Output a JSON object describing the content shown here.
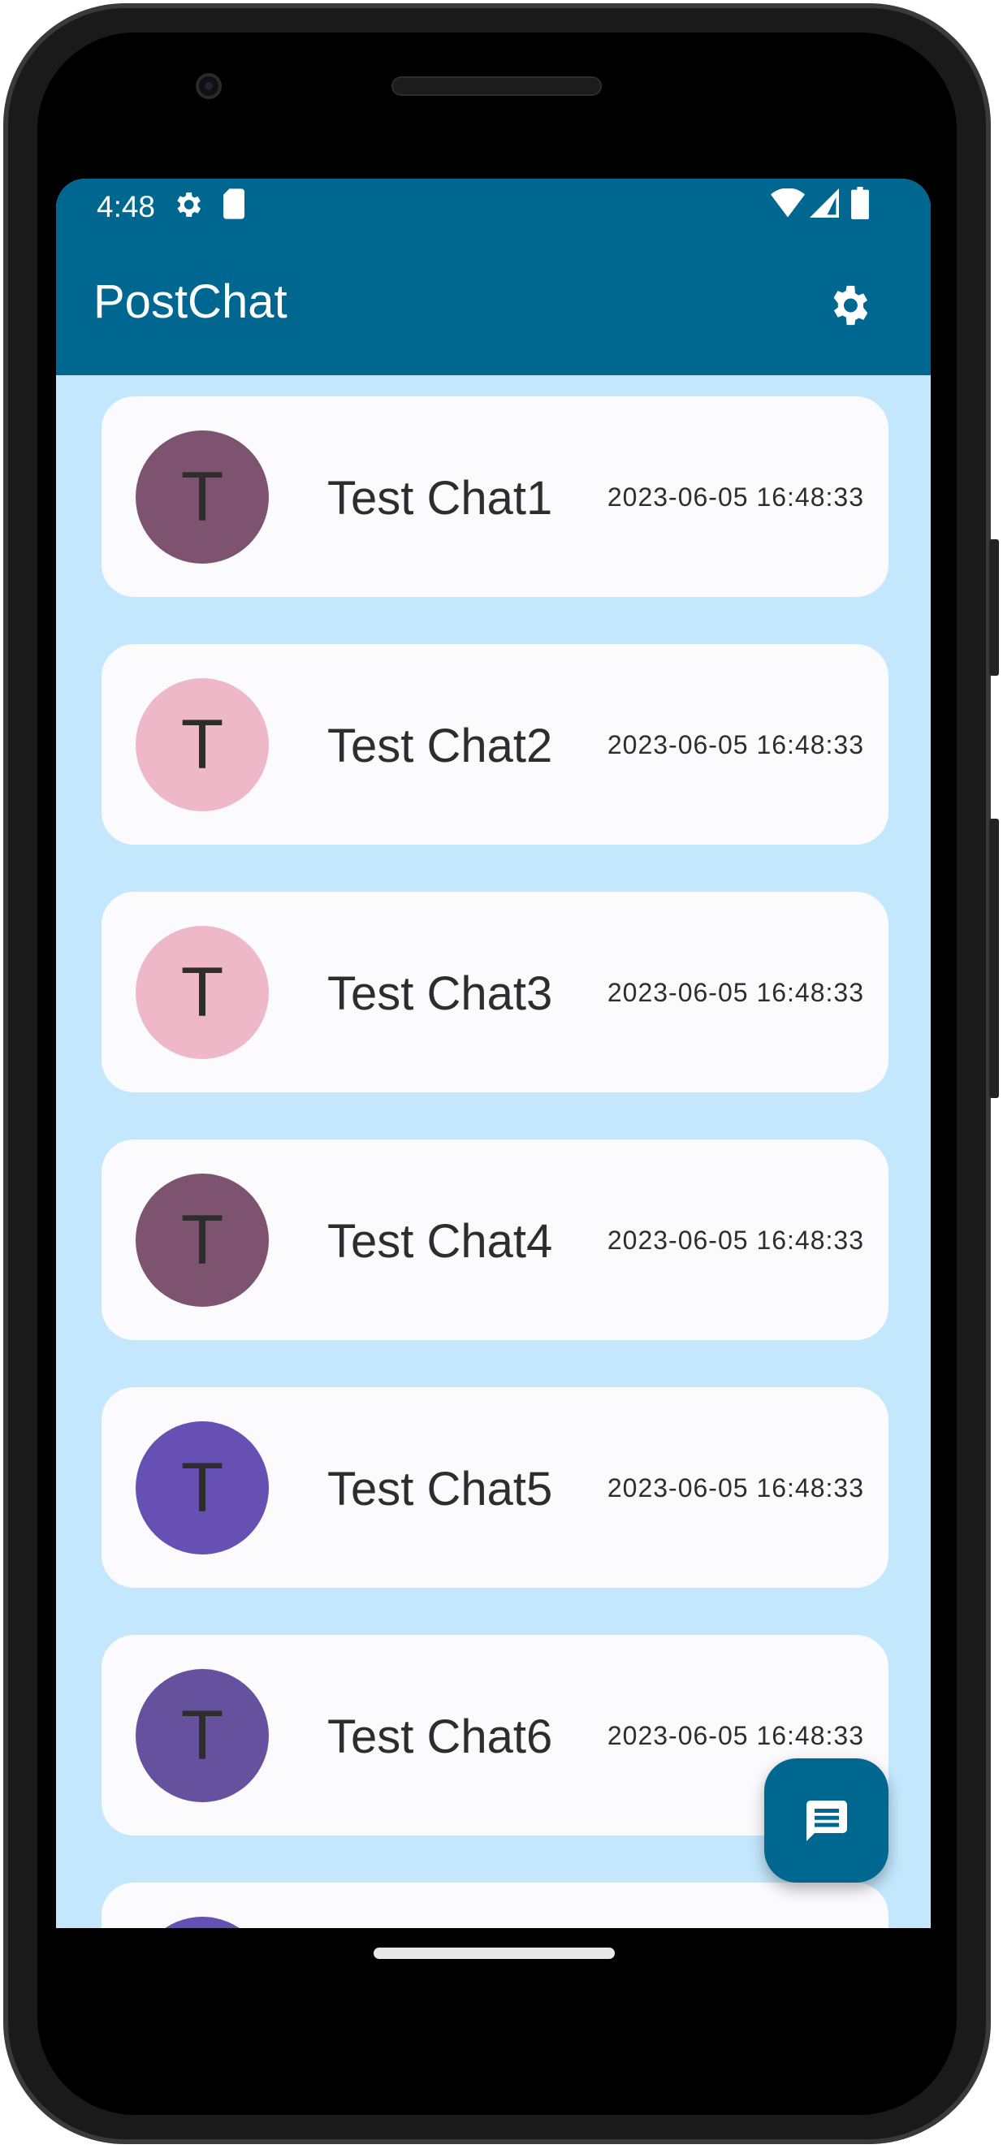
{
  "status_bar": {
    "time": "4:48",
    "icons": [
      "settings-gear-icon",
      "sd-card-icon",
      "wifi-icon",
      "signal-icon",
      "battery-icon"
    ]
  },
  "app_bar": {
    "title": "PostChat",
    "action_icon": "settings-icon"
  },
  "colors": {
    "primary": "#006890",
    "background": "#c3e7fd",
    "card": "#fbfbfe"
  },
  "chats": [
    {
      "initial": "T",
      "name": "Test Chat1",
      "timestamp": "2023-06-05 16:48:33",
      "avatar_color": "#7d5370"
    },
    {
      "initial": "T",
      "name": "Test Chat2",
      "timestamp": "2023-06-05 16:48:33",
      "avatar_color": "#efb8c8"
    },
    {
      "initial": "T",
      "name": "Test Chat3",
      "timestamp": "2023-06-05 16:48:33",
      "avatar_color": "#efb8c8"
    },
    {
      "initial": "T",
      "name": "Test Chat4",
      "timestamp": "2023-06-05 16:48:33",
      "avatar_color": "#7d5370"
    },
    {
      "initial": "T",
      "name": "Test Chat5",
      "timestamp": "2023-06-05 16:48:33",
      "avatar_color": "#6750b4"
    },
    {
      "initial": "T",
      "name": "Test Chat6",
      "timestamp": "2023-06-05 16:48:33",
      "avatar_color": "#66519f"
    },
    {
      "initial": "",
      "name": "",
      "timestamp": "",
      "avatar_color": "#6750b4"
    }
  ],
  "fab": {
    "icon": "chat-message-icon"
  }
}
